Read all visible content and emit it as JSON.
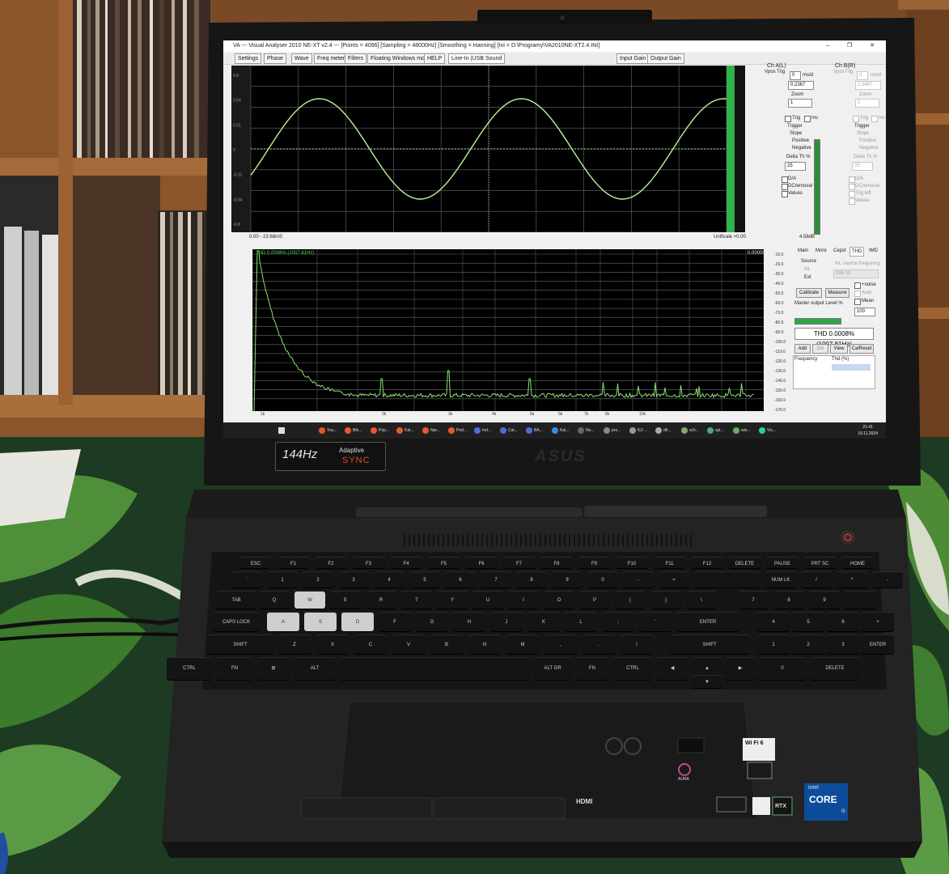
{
  "window": {
    "title": "VA --- Visual Analyser 2010 NE-XT v2.4 --- [Points = 4096] [Sampling = 48000Hz] [Smoothing = Hanning] [Ini = D:\\Programy\\VA2010NE-XT2.4.INI]",
    "controls": "– ❐ ✕"
  },
  "toolbar": {
    "buttons": [
      "Settings",
      "Phase",
      "Wave",
      "Freq meter",
      "Filters",
      "Floating Windows mode",
      "HELP"
    ],
    "input_device": "Line-In (USB Sound",
    "gain_buttons": [
      "Input Gain",
      "Output Gain"
    ]
  },
  "scope": {
    "left_ticks": [
      "0.8",
      "0.54",
      "0.31",
      "0",
      "-0.31",
      "-0.54",
      "-0.8"
    ],
    "right_ticks": [
      "36.96",
      "24.64",
      "12.32",
      "0.00",
      "-12.32",
      "-24.64",
      "-36.96"
    ],
    "bottom_left": "0.00 - 23.68mS",
    "bottom_right": "Unificale +0.00"
  },
  "channel_a": {
    "title": "Ch A(L)",
    "vpos_label": "Vpos",
    "trig_label": "Trig",
    "vpos_value": "0",
    "ms_label": "ms/d",
    "ms_value": "0.2367",
    "zoom_label": "Zoom",
    "zoom_value": "1",
    "trig": "Trig",
    "inv": "Inv",
    "trigger": "Trigger",
    "slope": "Slope",
    "positive": "Positive",
    "negative": "Negative",
    "delta_label": "Delta Th %",
    "delta_value": "25",
    "options": [
      "D/A",
      "DCremoval",
      "Values"
    ],
    "level": "4.58dB"
  },
  "channel_b": {
    "title": "Ch B(R)",
    "vpos_label": "Vpos",
    "trig_label": "Trig",
    "vpos_value": "0",
    "ms_label": "ms/d",
    "ms_value": "2.3667",
    "zoom_label": "Zoom",
    "zoom_value": "1",
    "trig": "Trig",
    "inv": "Inv",
    "trigger": "Trigger",
    "slope": "Slope",
    "positive": "Positive",
    "negative": "Negative",
    "delta_label": "Delta Th %",
    "delta_value": "25",
    "options": [
      "D/A",
      "DCremoval",
      "Trig left",
      "Values"
    ]
  },
  "thd_panel": {
    "tabs": [
      "Main",
      "More",
      "Cepst",
      "THD",
      "IMD"
    ],
    "source_label": "Source",
    "source_opts": [
      "Int",
      "Ext"
    ],
    "int_freq_label": "Int. source frequency",
    "int_freq_value": "996.09",
    "calibrate": "Calibrate",
    "measure": "Measure",
    "noise": "+noise",
    "auto": "Auto",
    "mean": "Mean",
    "master_label": "Master output Level %",
    "master_value": "100",
    "readout": "THD 0.0008% (1007.81Hz)",
    "buttons": [
      "Add",
      "Del",
      "View",
      "CalReset"
    ],
    "col_frequency": "Frequency",
    "col_thd": "Thd (%)"
  },
  "spectrum": {
    "label": "THD 0.0008% (1007.81Hz)",
    "peak": "0.00000",
    "db_ticks": [
      "-10.0",
      "-20.0",
      "-30.0",
      "-40.0",
      "-50.0",
      "-60.0",
      "-70.0",
      "-80.0",
      "-90.0",
      "-100.0",
      "-110.0",
      "-120.0",
      "-130.0",
      "-140.0",
      "-150.0",
      "-160.0",
      "-170.0"
    ],
    "freq_ticks": [
      "1k",
      "2k",
      "3k",
      "4k",
      "5k",
      "6k",
      "7k",
      "8k",
      "10k"
    ]
  },
  "taskbar": {
    "apps": [
      "You...",
      "Bib...",
      "Pop...",
      "Kat...",
      "Nar...",
      "Pod...",
      "Ind...",
      "Cal...",
      "BA...",
      "Kal...",
      "No...",
      "pro...",
      "KZ-...",
      "dfr...",
      "sch...",
      "spl...",
      "wie...",
      "Vis..."
    ],
    "time": "21:41",
    "date": "19.11.2024"
  },
  "bezel": {
    "refresh": "144Hz",
    "adaptive_1": "Adaptive",
    "adaptive_2": "SYNC",
    "brand": "ASUS"
  },
  "keyboard": {
    "row_fn": [
      "ESC",
      "F1",
      "F2",
      "F3",
      "F4",
      "F5",
      "F6",
      "F7",
      "F8",
      "F9",
      "F10",
      "F11",
      "F12",
      "DELETE",
      "PAUSE",
      "PRT SC",
      "HOME"
    ],
    "row_num": [
      "`",
      "1",
      "2",
      "3",
      "4",
      "5",
      "6",
      "7",
      "8",
      "9",
      "0",
      "-",
      "=",
      "",
      "NUM LK",
      "/",
      "*",
      "-"
    ],
    "row_q": [
      "TAB",
      "Q",
      "W",
      "E",
      "R",
      "T",
      "Y",
      "U",
      "I",
      "O",
      "P",
      "[",
      "]",
      "\\",
      "7",
      "8",
      "9",
      ""
    ],
    "row_a": [
      "CAPS LOCK",
      "A",
      "S",
      "D",
      "F",
      "G",
      "H",
      "J",
      "K",
      "L",
      ";",
      "'",
      "ENTER",
      "4",
      "5",
      "6",
      "+"
    ],
    "row_z": [
      "SHIFT",
      "Z",
      "X",
      "C",
      "V",
      "B",
      "N",
      "M",
      ",",
      ".",
      "/",
      "SHIFT",
      "1",
      "2",
      "3",
      "ENTER"
    ],
    "row_ctrl": [
      "CTRL",
      "FN",
      "⊞",
      "ALT",
      "",
      "ALT GR",
      "FN",
      "CTRL",
      "◀",
      "▲",
      "▶",
      "0",
      "DELETE"
    ],
    "row_arrow_down": "▼"
  },
  "stickers": {
    "hdmi": "HDMI",
    "intel_1": "intel",
    "intel_2": "CORE",
    "intel_3": "i5",
    "wifi": "Wi Fi 6",
    "rtx": "RTX",
    "aura": "AURA"
  },
  "chart_data": {
    "type": "line",
    "series": [
      {
        "name": "",
        "values": []
      }
    ]
  }
}
